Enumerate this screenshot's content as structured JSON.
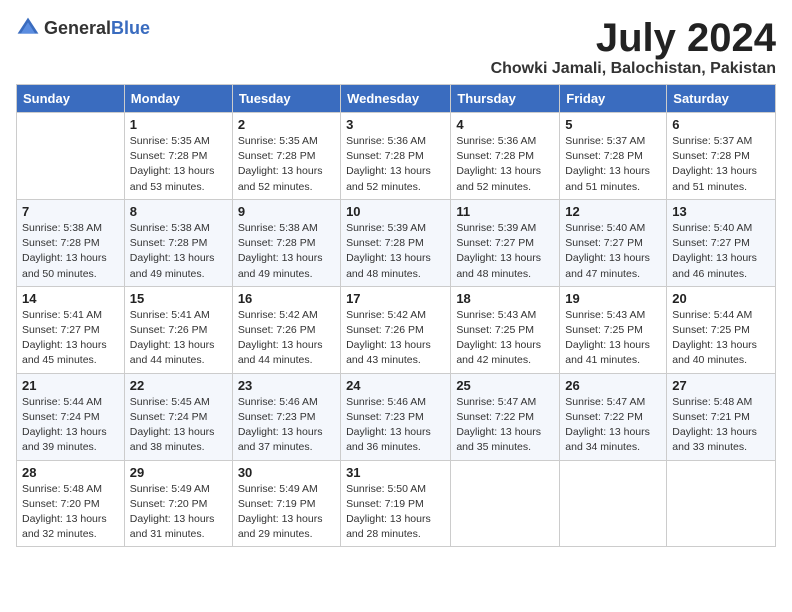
{
  "header": {
    "logo_general": "General",
    "logo_blue": "Blue",
    "month_title": "July 2024",
    "location": "Chowki Jamali, Balochistan, Pakistan"
  },
  "days_of_week": [
    "Sunday",
    "Monday",
    "Tuesday",
    "Wednesday",
    "Thursday",
    "Friday",
    "Saturday"
  ],
  "weeks": [
    [
      {
        "day": "",
        "sunrise": "",
        "sunset": "",
        "daylight": ""
      },
      {
        "day": "1",
        "sunrise": "Sunrise: 5:35 AM",
        "sunset": "Sunset: 7:28 PM",
        "daylight": "Daylight: 13 hours and 53 minutes."
      },
      {
        "day": "2",
        "sunrise": "Sunrise: 5:35 AM",
        "sunset": "Sunset: 7:28 PM",
        "daylight": "Daylight: 13 hours and 52 minutes."
      },
      {
        "day": "3",
        "sunrise": "Sunrise: 5:36 AM",
        "sunset": "Sunset: 7:28 PM",
        "daylight": "Daylight: 13 hours and 52 minutes."
      },
      {
        "day": "4",
        "sunrise": "Sunrise: 5:36 AM",
        "sunset": "Sunset: 7:28 PM",
        "daylight": "Daylight: 13 hours and 52 minutes."
      },
      {
        "day": "5",
        "sunrise": "Sunrise: 5:37 AM",
        "sunset": "Sunset: 7:28 PM",
        "daylight": "Daylight: 13 hours and 51 minutes."
      },
      {
        "day": "6",
        "sunrise": "Sunrise: 5:37 AM",
        "sunset": "Sunset: 7:28 PM",
        "daylight": "Daylight: 13 hours and 51 minutes."
      }
    ],
    [
      {
        "day": "7",
        "sunrise": "Sunrise: 5:38 AM",
        "sunset": "Sunset: 7:28 PM",
        "daylight": "Daylight: 13 hours and 50 minutes."
      },
      {
        "day": "8",
        "sunrise": "Sunrise: 5:38 AM",
        "sunset": "Sunset: 7:28 PM",
        "daylight": "Daylight: 13 hours and 49 minutes."
      },
      {
        "day": "9",
        "sunrise": "Sunrise: 5:38 AM",
        "sunset": "Sunset: 7:28 PM",
        "daylight": "Daylight: 13 hours and 49 minutes."
      },
      {
        "day": "10",
        "sunrise": "Sunrise: 5:39 AM",
        "sunset": "Sunset: 7:28 PM",
        "daylight": "Daylight: 13 hours and 48 minutes."
      },
      {
        "day": "11",
        "sunrise": "Sunrise: 5:39 AM",
        "sunset": "Sunset: 7:27 PM",
        "daylight": "Daylight: 13 hours and 48 minutes."
      },
      {
        "day": "12",
        "sunrise": "Sunrise: 5:40 AM",
        "sunset": "Sunset: 7:27 PM",
        "daylight": "Daylight: 13 hours and 47 minutes."
      },
      {
        "day": "13",
        "sunrise": "Sunrise: 5:40 AM",
        "sunset": "Sunset: 7:27 PM",
        "daylight": "Daylight: 13 hours and 46 minutes."
      }
    ],
    [
      {
        "day": "14",
        "sunrise": "Sunrise: 5:41 AM",
        "sunset": "Sunset: 7:27 PM",
        "daylight": "Daylight: 13 hours and 45 minutes."
      },
      {
        "day": "15",
        "sunrise": "Sunrise: 5:41 AM",
        "sunset": "Sunset: 7:26 PM",
        "daylight": "Daylight: 13 hours and 44 minutes."
      },
      {
        "day": "16",
        "sunrise": "Sunrise: 5:42 AM",
        "sunset": "Sunset: 7:26 PM",
        "daylight": "Daylight: 13 hours and 44 minutes."
      },
      {
        "day": "17",
        "sunrise": "Sunrise: 5:42 AM",
        "sunset": "Sunset: 7:26 PM",
        "daylight": "Daylight: 13 hours and 43 minutes."
      },
      {
        "day": "18",
        "sunrise": "Sunrise: 5:43 AM",
        "sunset": "Sunset: 7:25 PM",
        "daylight": "Daylight: 13 hours and 42 minutes."
      },
      {
        "day": "19",
        "sunrise": "Sunrise: 5:43 AM",
        "sunset": "Sunset: 7:25 PM",
        "daylight": "Daylight: 13 hours and 41 minutes."
      },
      {
        "day": "20",
        "sunrise": "Sunrise: 5:44 AM",
        "sunset": "Sunset: 7:25 PM",
        "daylight": "Daylight: 13 hours and 40 minutes."
      }
    ],
    [
      {
        "day": "21",
        "sunrise": "Sunrise: 5:44 AM",
        "sunset": "Sunset: 7:24 PM",
        "daylight": "Daylight: 13 hours and 39 minutes."
      },
      {
        "day": "22",
        "sunrise": "Sunrise: 5:45 AM",
        "sunset": "Sunset: 7:24 PM",
        "daylight": "Daylight: 13 hours and 38 minutes."
      },
      {
        "day": "23",
        "sunrise": "Sunrise: 5:46 AM",
        "sunset": "Sunset: 7:23 PM",
        "daylight": "Daylight: 13 hours and 37 minutes."
      },
      {
        "day": "24",
        "sunrise": "Sunrise: 5:46 AM",
        "sunset": "Sunset: 7:23 PM",
        "daylight": "Daylight: 13 hours and 36 minutes."
      },
      {
        "day": "25",
        "sunrise": "Sunrise: 5:47 AM",
        "sunset": "Sunset: 7:22 PM",
        "daylight": "Daylight: 13 hours and 35 minutes."
      },
      {
        "day": "26",
        "sunrise": "Sunrise: 5:47 AM",
        "sunset": "Sunset: 7:22 PM",
        "daylight": "Daylight: 13 hours and 34 minutes."
      },
      {
        "day": "27",
        "sunrise": "Sunrise: 5:48 AM",
        "sunset": "Sunset: 7:21 PM",
        "daylight": "Daylight: 13 hours and 33 minutes."
      }
    ],
    [
      {
        "day": "28",
        "sunrise": "Sunrise: 5:48 AM",
        "sunset": "Sunset: 7:20 PM",
        "daylight": "Daylight: 13 hours and 32 minutes."
      },
      {
        "day": "29",
        "sunrise": "Sunrise: 5:49 AM",
        "sunset": "Sunset: 7:20 PM",
        "daylight": "Daylight: 13 hours and 31 minutes."
      },
      {
        "day": "30",
        "sunrise": "Sunrise: 5:49 AM",
        "sunset": "Sunset: 7:19 PM",
        "daylight": "Daylight: 13 hours and 29 minutes."
      },
      {
        "day": "31",
        "sunrise": "Sunrise: 5:50 AM",
        "sunset": "Sunset: 7:19 PM",
        "daylight": "Daylight: 13 hours and 28 minutes."
      },
      {
        "day": "",
        "sunrise": "",
        "sunset": "",
        "daylight": ""
      },
      {
        "day": "",
        "sunrise": "",
        "sunset": "",
        "daylight": ""
      },
      {
        "day": "",
        "sunrise": "",
        "sunset": "",
        "daylight": ""
      }
    ]
  ]
}
